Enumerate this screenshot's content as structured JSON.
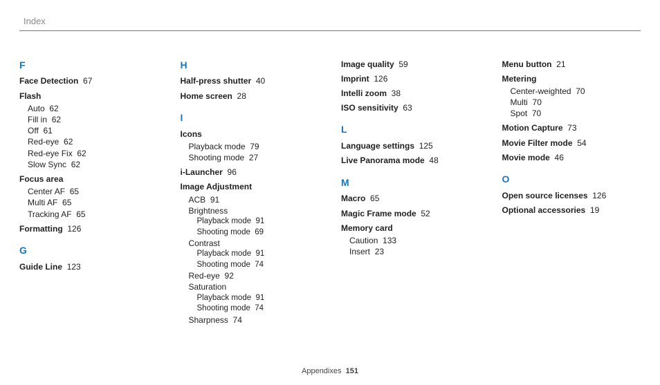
{
  "header": {
    "title": "Index"
  },
  "footer": {
    "label": "Appendixes",
    "page": "151"
  },
  "letters": {
    "F": "F",
    "G": "G",
    "H": "H",
    "I": "I",
    "L": "L",
    "M": "M",
    "O": "O"
  },
  "f": {
    "faceDetection": {
      "label": "Face Detection",
      "page": "67"
    },
    "flash": {
      "label": "Flash",
      "auto": {
        "label": "Auto",
        "page": "62"
      },
      "fillIn": {
        "label": "Fill in",
        "page": "62"
      },
      "off": {
        "label": "Off",
        "page": "61"
      },
      "redEye": {
        "label": "Red-eye",
        "page": "62"
      },
      "redEyeFix": {
        "label": "Red-eye Fix",
        "page": "62"
      },
      "slowSync": {
        "label": "Slow Sync",
        "page": "62"
      }
    },
    "focusArea": {
      "label": "Focus area",
      "centerAf": {
        "label": "Center AF",
        "page": "65"
      },
      "multiAf": {
        "label": "Multi AF",
        "page": "65"
      },
      "trackingAf": {
        "label": "Tracking AF",
        "page": "65"
      }
    },
    "formatting": {
      "label": "Formatting",
      "page": "126"
    }
  },
  "g": {
    "guideLine": {
      "label": "Guide Line",
      "page": "123"
    }
  },
  "h": {
    "halfPress": {
      "label": "Half-press shutter",
      "page": "40"
    },
    "homeScreen": {
      "label": "Home screen",
      "page": "28"
    }
  },
  "i": {
    "icons": {
      "label": "Icons",
      "playback": {
        "label": "Playback mode",
        "page": "79"
      },
      "shooting": {
        "label": "Shooting mode",
        "page": "27"
      }
    },
    "iLauncher": {
      "label": "i-Launcher",
      "page": "96"
    },
    "imageAdjustment": {
      "label": "Image Adjustment",
      "acb": {
        "label": "ACB",
        "page": "91"
      },
      "brightness": {
        "label": "Brightness",
        "playback": {
          "label": "Playback mode",
          "page": "91"
        },
        "shooting": {
          "label": "Shooting mode",
          "page": "69"
        }
      },
      "contrast": {
        "label": "Contrast",
        "playback": {
          "label": "Playback mode",
          "page": "91"
        },
        "shooting": {
          "label": "Shooting mode",
          "page": "74"
        }
      },
      "redEye": {
        "label": "Red-eye",
        "page": "92"
      },
      "saturation": {
        "label": "Saturation",
        "playback": {
          "label": "Playback mode",
          "page": "91"
        },
        "shooting": {
          "label": "Shooting mode",
          "page": "74"
        }
      },
      "sharpness": {
        "label": "Sharpness",
        "page": "74"
      }
    }
  },
  "col3top": {
    "imageQuality": {
      "label": "Image quality",
      "page": "59"
    },
    "imprint": {
      "label": "Imprint",
      "page": "126"
    },
    "intelliZoom": {
      "label": "Intelli zoom",
      "page": "38"
    },
    "iso": {
      "label": "ISO sensitivity",
      "page": "63"
    }
  },
  "l": {
    "languageSettings": {
      "label": "Language settings",
      "page": "125"
    },
    "livePanorama": {
      "label": "Live Panorama mode",
      "page": "48"
    }
  },
  "m": {
    "macro": {
      "label": "Macro",
      "page": "65"
    },
    "magicFrame": {
      "label": "Magic Frame mode",
      "page": "52"
    },
    "memoryCard": {
      "label": "Memory card",
      "caution": {
        "label": "Caution",
        "page": "133"
      },
      "insert": {
        "label": "Insert",
        "page": "23"
      }
    }
  },
  "col4top": {
    "menuButton": {
      "label": "Menu button",
      "page": "21"
    },
    "metering": {
      "label": "Metering",
      "center": {
        "label": "Center-weighted",
        "page": "70"
      },
      "multi": {
        "label": "Multi",
        "page": "70"
      },
      "spot": {
        "label": "Spot",
        "page": "70"
      }
    },
    "motionCapture": {
      "label": "Motion Capture",
      "page": "73"
    },
    "movieFilter": {
      "label": "Movie Filter mode",
      "page": "54"
    },
    "movieMode": {
      "label": "Movie mode",
      "page": "46"
    }
  },
  "o": {
    "openSource": {
      "label": "Open source licenses",
      "page": "126"
    },
    "optionalAcc": {
      "label": "Optional accessories",
      "page": "19"
    }
  }
}
